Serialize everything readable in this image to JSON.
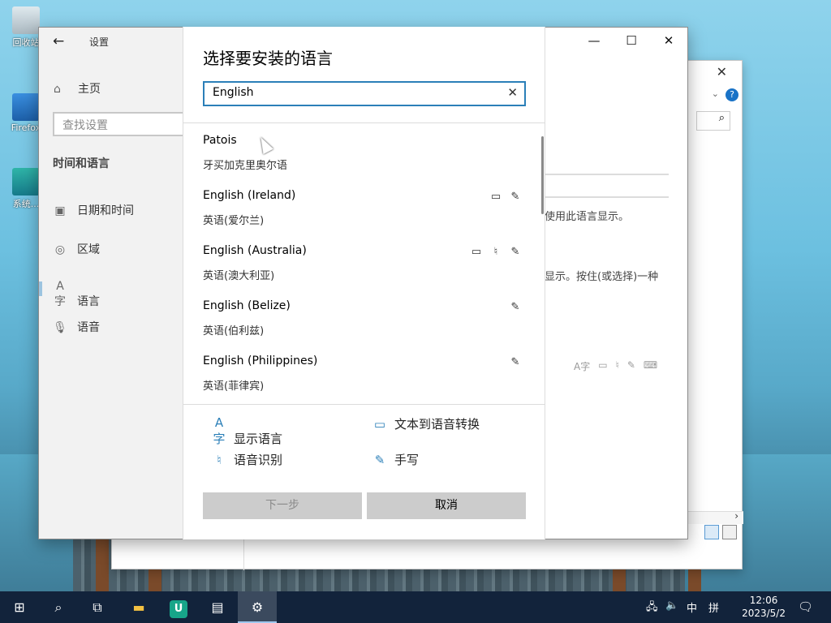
{
  "desktop": {
    "icons": [
      {
        "name": "recycle-bin",
        "label": "回收站"
      },
      {
        "name": "firefox",
        "label": "Firefox"
      },
      {
        "name": "system",
        "label": "系统..."
      }
    ]
  },
  "settings": {
    "app_title": "设置",
    "home_label": "主页",
    "search_placeholder": "查找设置",
    "section_title": "时间和语言",
    "nav_items": [
      {
        "label": "日期和时间",
        "icon": "calendar-clock-icon"
      },
      {
        "label": "区域",
        "icon": "globe-icon"
      },
      {
        "label": "语言",
        "icon": "language-icon"
      },
      {
        "label": "语音",
        "icon": "microphone-icon"
      }
    ],
    "peek_texts": [
      "使用此语言显示。",
      "显示。按住(或选择)一种"
    ]
  },
  "dialog": {
    "title": "选择要安装的语言",
    "search_value": "English",
    "languages": [
      {
        "en": "Patois",
        "cn": "牙买加克里奥尔语",
        "features": []
      },
      {
        "en": "English (Ireland)",
        "cn": "英语(爱尔兰)",
        "features": [
          "tts",
          "handwriting"
        ]
      },
      {
        "en": "English (Australia)",
        "cn": "英语(澳大利亚)",
        "features": [
          "tts",
          "speech",
          "handwriting"
        ]
      },
      {
        "en": "English (Belize)",
        "cn": "英语(伯利兹)",
        "features": [
          "handwriting"
        ]
      },
      {
        "en": "English (Philippines)",
        "cn": "英语(菲律宾)",
        "features": [
          "handwriting"
        ]
      }
    ],
    "legend": {
      "display_language": "显示语言",
      "tts": "文本到语音转换",
      "speech": "语音识别",
      "handwriting": "手写"
    },
    "next_button": "下一步",
    "cancel_button": "取消"
  },
  "taskbar": {
    "tray_ime": "中",
    "tray_layout": "拼",
    "time": "12:06",
    "date": "2023/5/2"
  }
}
